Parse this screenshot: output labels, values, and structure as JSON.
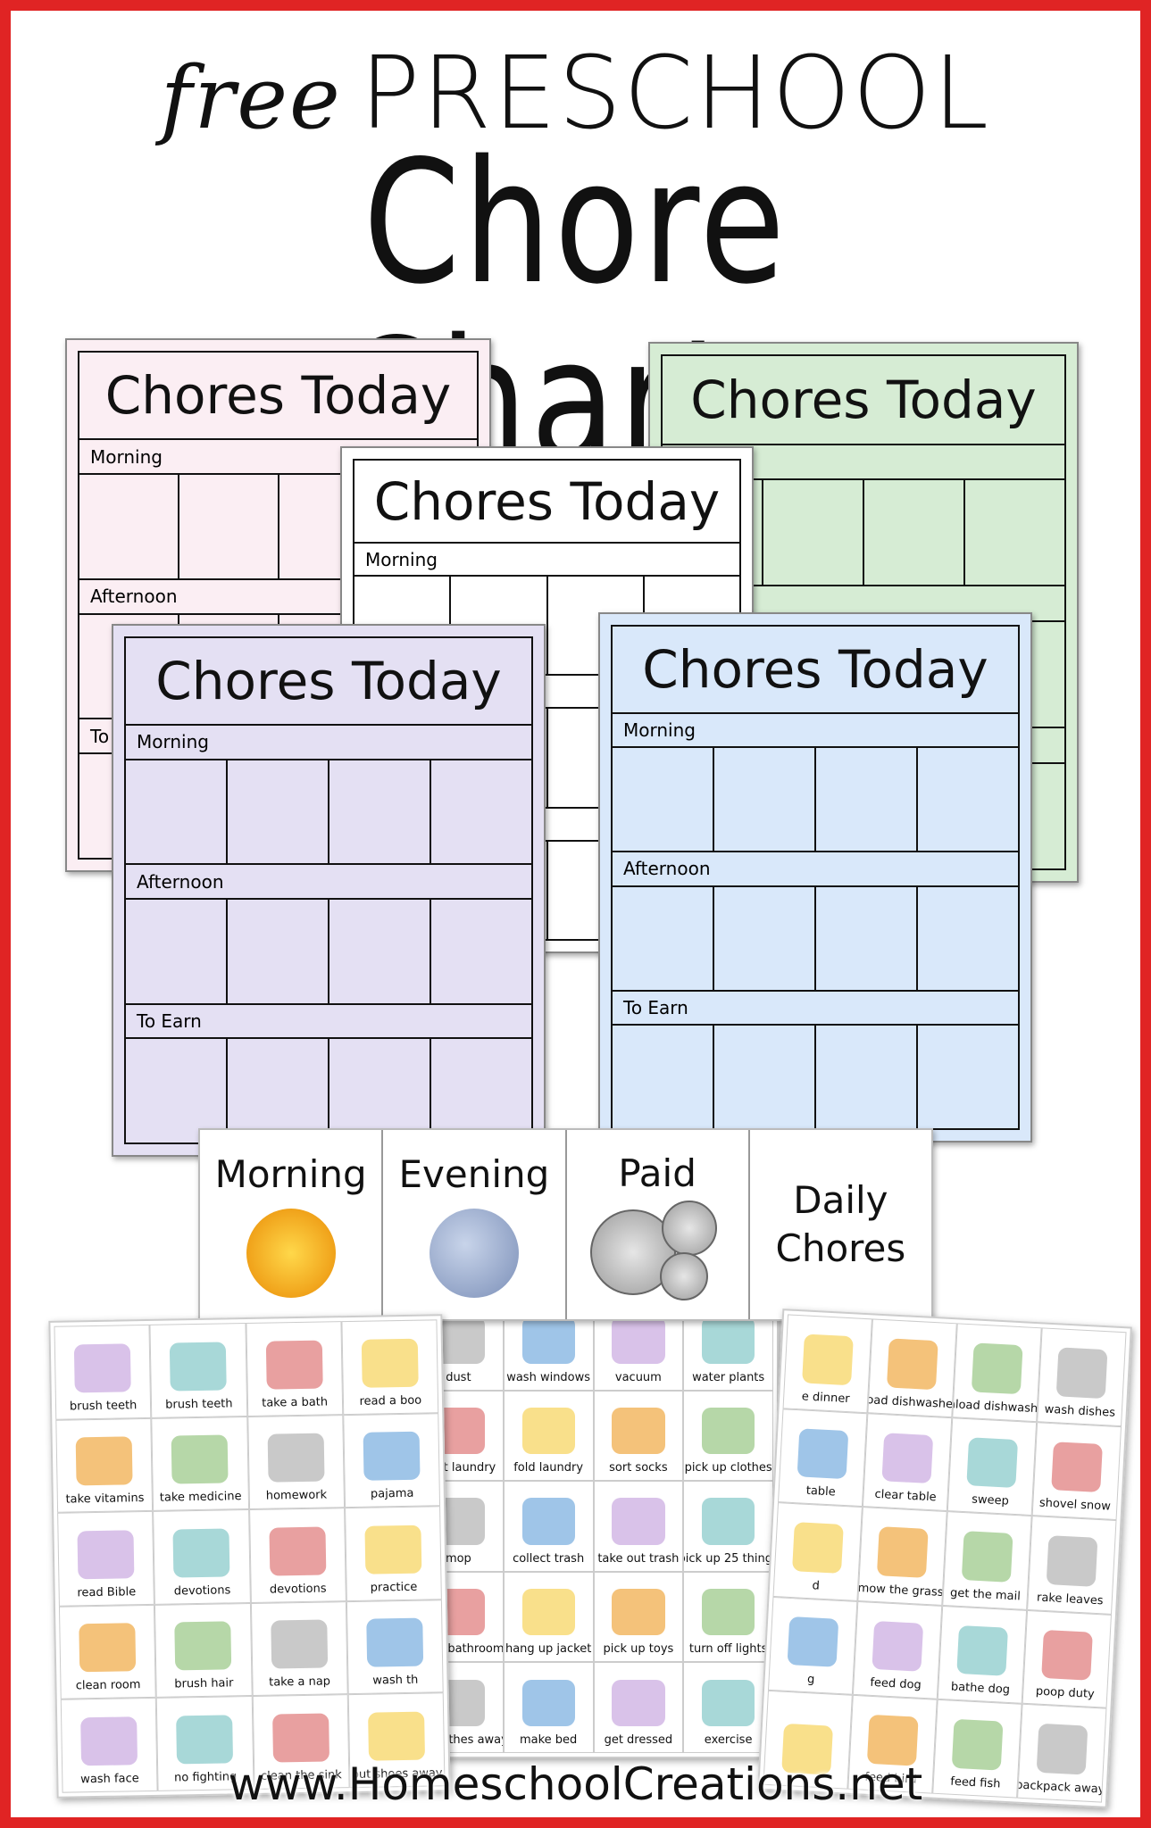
{
  "title": {
    "line1_script": "free",
    "line1": "PRESCHOOL",
    "line2": "Chore Charts"
  },
  "charts": [
    {
      "id": "pink",
      "title": "Chores Today",
      "color": "#fbeef3",
      "sections": [
        "Morning",
        "Afternoon",
        "To"
      ]
    },
    {
      "id": "green",
      "title": "Chores Today",
      "color": "#d6ecd4",
      "sections": [
        "",
        "",
        ""
      ]
    },
    {
      "id": "white",
      "title": "Chores Today",
      "color": "#ffffff",
      "sections": [
        "Morning",
        "",
        ""
      ]
    },
    {
      "id": "purple",
      "title": "Chores Today",
      "color": "#e4e0f3",
      "sections": [
        "Morning",
        "Afternoon",
        "To Earn"
      ]
    },
    {
      "id": "blue",
      "title": "Chores Today",
      "color": "#d9e8fa",
      "sections": [
        "Morning",
        "Afternoon",
        "To Earn"
      ]
    }
  ],
  "strip": {
    "morning": "Morning",
    "evening": "Evening",
    "paid": "Paid",
    "daily": "Daily Chores",
    "icons": [
      "sun-icon",
      "moon-icon",
      "coins-icon"
    ]
  },
  "sheets": {
    "left": [
      "brush teeth",
      "brush teeth",
      "take a bath",
      "read a boo",
      "take vitamins",
      "take medicine",
      "homework",
      "pajama",
      "read Bible",
      "devotions",
      "devotions",
      "practice",
      "clean room",
      "brush hair",
      "take a nap",
      "wash th",
      "wash face",
      "no fighting",
      "clean the sink",
      "put shoes away"
    ],
    "middle": [
      "dust",
      "wash windows",
      "vacuum",
      "water plants",
      "start laundry",
      "fold laundry",
      "sort socks",
      "pick up clothes",
      "mop",
      "collect trash",
      "take out trash",
      "pick up 25 things",
      "clean bathroom",
      "hang up jacket",
      "pick up toys",
      "turn off lights",
      "put clothes away",
      "make bed",
      "get dressed",
      "exercise"
    ],
    "right": [
      "e dinner",
      "load dishwasher",
      "unload dishwasher",
      "wash dishes",
      "table",
      "clear table",
      "sweep",
      "shovel snow",
      "d",
      "mow the grass",
      "get the mail",
      "rake leaves",
      "g",
      "feed dog",
      "bathe dog",
      "poop duty",
      "",
      "feed bird",
      "feed fish",
      "backpack away"
    ]
  },
  "footer": {
    "url": "www.HomeschoolCreations.net"
  },
  "colors": {
    "border": "#e02424"
  }
}
